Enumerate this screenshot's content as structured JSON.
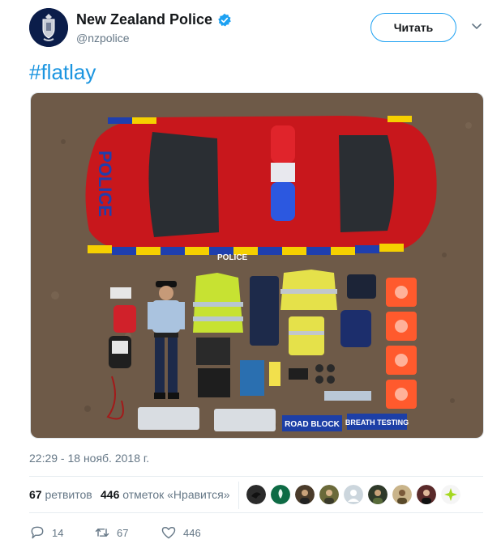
{
  "tweet": {
    "display_name": "New Zealand Police",
    "handle": "@nzpolice",
    "follow_label": "Читать",
    "text": "#flatlay",
    "timestamp": "22:29 - 18 нояб. 2018 г.",
    "photo_texts": {
      "car_side": "POLICE",
      "car_door": "POLICE",
      "sign_left": "ROAD BLOCK",
      "sign_right": "BREATH TESTING"
    }
  },
  "stats": {
    "retweets_count": "67",
    "retweets_label": "ретвитов",
    "likes_count": "446",
    "likes_label": "отметок «Нравится»"
  },
  "likers": [
    {
      "icon": "bird-avatar",
      "color": "#2b2b2b"
    },
    {
      "icon": "leaf-avatar",
      "color": "#0e6b45"
    },
    {
      "icon": "person-avatar",
      "color": "#4a3b2a"
    },
    {
      "icon": "person-avatar",
      "color": "#6b6a3a"
    },
    {
      "icon": "default-avatar",
      "color": "#ccd6dd"
    },
    {
      "icon": "person-avatar",
      "color": "#2f3a2a"
    },
    {
      "icon": "person-avatar",
      "color": "#c9b48a"
    },
    {
      "icon": "person-avatar",
      "color": "#5a2a2a"
    },
    {
      "icon": "sparkle-avatar",
      "color": "#f5f5f5"
    }
  ],
  "actions": {
    "replies": "14",
    "retweets": "67",
    "likes": "446"
  },
  "colors": {
    "brand_blue": "#1da1f2",
    "link_blue": "#1b95e0",
    "muted": "#657786"
  }
}
